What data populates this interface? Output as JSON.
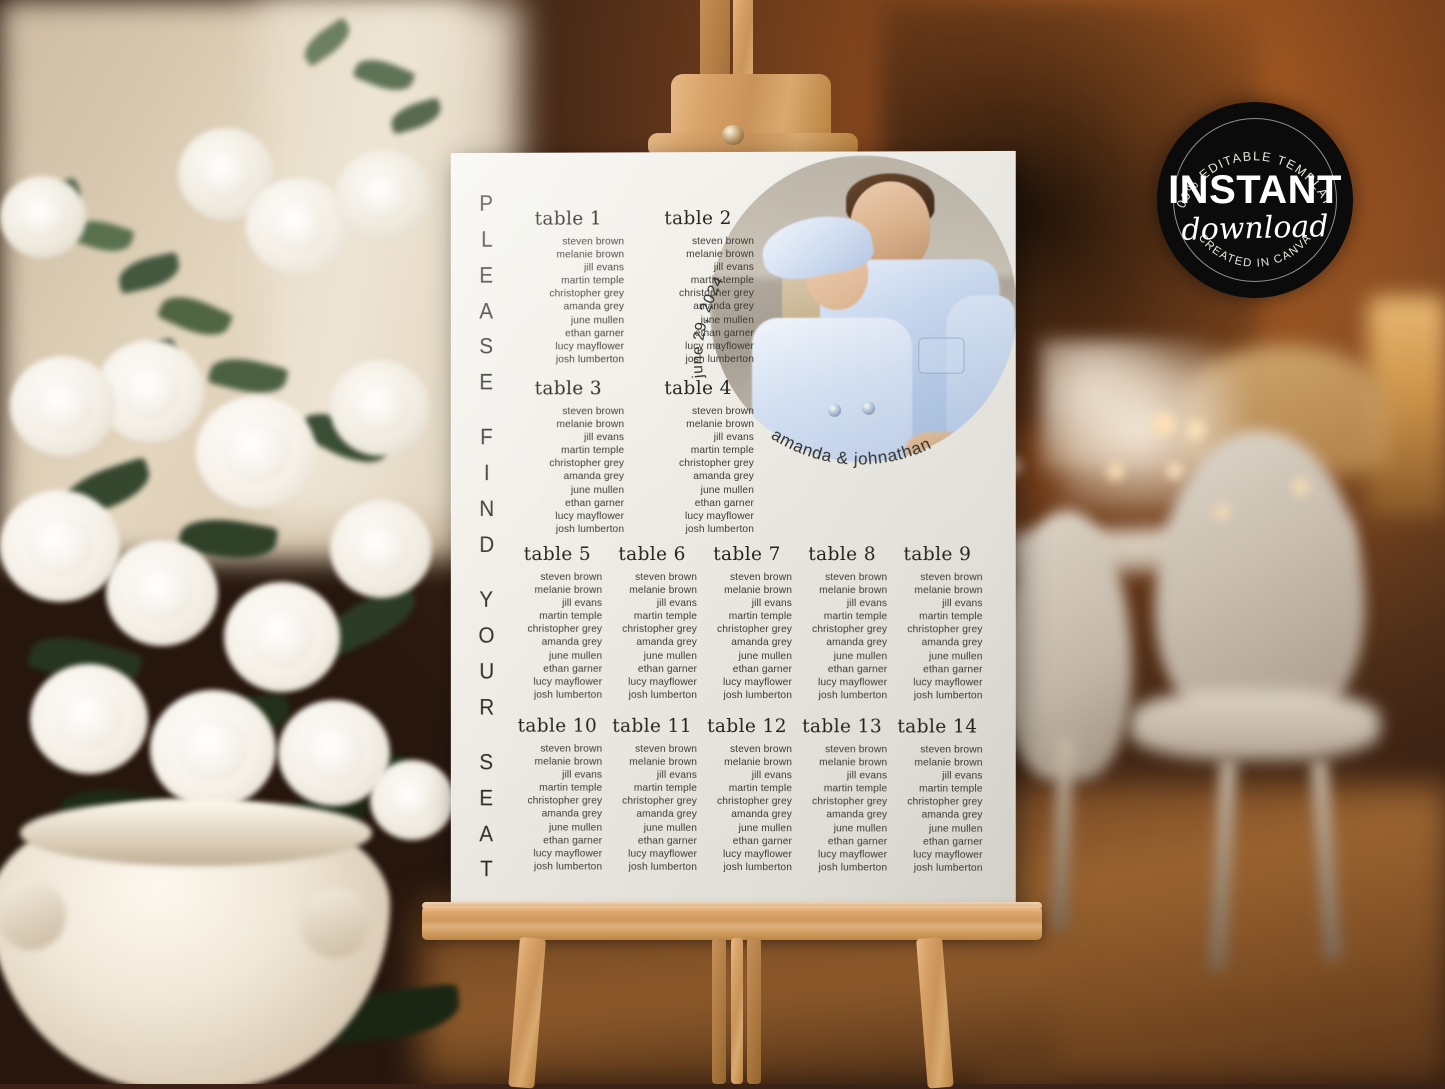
{
  "scene": {
    "description": "wedding seating chart poster on wooden easel",
    "easel": {
      "material_label": "wooden-easel"
    },
    "left_decor": {
      "label": "white-rose-arrangement",
      "vase_label": "ceramic-urn-vase"
    },
    "right_decor": {
      "label": "blurred-reception-table-and-chairs"
    }
  },
  "poster": {
    "vertical_title": "PLEASE FIND YOUR SEAT",
    "vertical_letters": [
      "P",
      "L",
      "E",
      "A",
      "S",
      "E",
      "F",
      "I",
      "N",
      "D",
      "Y",
      "O",
      "U",
      "R",
      "S",
      "E",
      "A",
      "T"
    ],
    "date": "june 29, 2024",
    "couple_names": "amanda & johnathan",
    "photo_alt": "engagement-photo-couple-embracing",
    "guest_list": [
      "steven brown",
      "melanie brown",
      "jill evans",
      "martin temple",
      "christopher grey",
      "amanda grey",
      "june mullen",
      "ethan garner",
      "lucy mayflower",
      "josh lumberton"
    ],
    "table_groups": [
      {
        "id": "group-a",
        "tables": [
          "table 1",
          "table 2"
        ]
      },
      {
        "id": "group-b",
        "tables": [
          "table 3",
          "table 4"
        ]
      },
      {
        "id": "group-c",
        "tables": [
          "table 5",
          "table 6",
          "table 7",
          "table 8",
          "table 9"
        ]
      },
      {
        "id": "group-d",
        "tables": [
          "table 10",
          "table 11",
          "table 12",
          "table 13",
          "table 14"
        ]
      }
    ],
    "colors": {
      "paper": "#f2f0ea",
      "ink": "#2b2b27",
      "name_ink": "#3c3b36"
    }
  },
  "badge": {
    "top_arc_text": "100% EDITABLE TEMPLATE",
    "main_text": "INSTANT",
    "script_text": "download",
    "bottom_arc_text": "CREATED IN CANVA",
    "background_color": "#0b0b0b",
    "text_color": "#ffffff"
  }
}
